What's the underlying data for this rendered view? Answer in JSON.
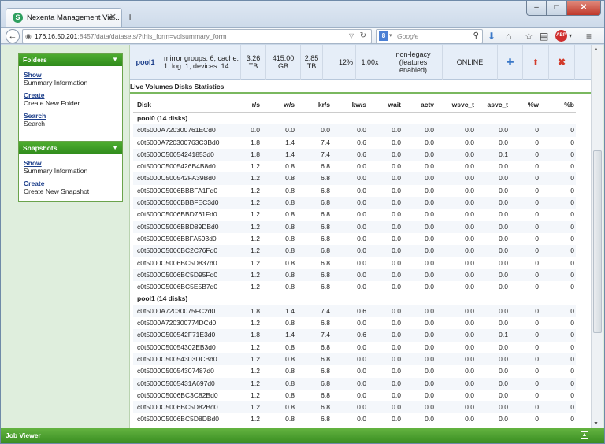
{
  "browser": {
    "tab_title": "Nexenta Management Vie...",
    "url_host": "176.16.50.201",
    "url_rest": ":8457/data/datasets/?this_form=volsummary_form",
    "search_placeholder": "Google",
    "search_engine_letter": "8"
  },
  "sidebar": {
    "folders": {
      "title": "Folders",
      "items": [
        {
          "link": "Show",
          "desc": "Summary Information"
        },
        {
          "link": "Create",
          "desc": "Create New Folder"
        },
        {
          "link": "Search",
          "desc": "Search"
        }
      ]
    },
    "snapshots": {
      "title": "Snapshots",
      "items": [
        {
          "link": "Show",
          "desc": "Summary Information"
        },
        {
          "link": "Create",
          "desc": "Create New Snapshot"
        }
      ]
    }
  },
  "pool": {
    "name": "pool1",
    "config": "mirror groups: 6, cache: 1, log: 1, devices: 14",
    "size": "3.26 TB",
    "allocated": "415.00 GB",
    "free": "2.85 TB",
    "capacity": "12%",
    "dedup": "1.00x",
    "version": "non-legacy (features enabled)",
    "health": "ONLINE"
  },
  "section_title": "Live Volumes Disks Statistics",
  "table": {
    "headers": [
      "Disk",
      "r/s",
      "w/s",
      "kr/s",
      "kw/s",
      "wait",
      "actv",
      "wsvc_t",
      "asvc_t",
      "%w",
      "%b"
    ],
    "groups": [
      {
        "label": "pool0 (14 disks)",
        "rows": [
          [
            "c0t5000A720300761ECd0",
            "0.0",
            "0.0",
            "0.0",
            "0.0",
            "0.0",
            "0.0",
            "0.0",
            "0.0",
            "0",
            "0"
          ],
          [
            "c0t5000A720300763C3Bd0",
            "1.8",
            "1.4",
            "7.4",
            "0.6",
            "0.0",
            "0.0",
            "0.0",
            "0.0",
            "0",
            "0"
          ],
          [
            "c0t5000C50054241853d0",
            "1.8",
            "1.4",
            "7.4",
            "0.6",
            "0.0",
            "0.0",
            "0.0",
            "0.1",
            "0",
            "0"
          ],
          [
            "c0t5000C5005426B4B8d0",
            "1.2",
            "0.8",
            "6.8",
            "0.0",
            "0.0",
            "0.0",
            "0.0",
            "0.0",
            "0",
            "0"
          ],
          [
            "c0t5000C500542FA39Bd0",
            "1.2",
            "0.8",
            "6.8",
            "0.0",
            "0.0",
            "0.0",
            "0.0",
            "0.0",
            "0",
            "0"
          ],
          [
            "c0t5000C5006BBBFA1Fd0",
            "1.2",
            "0.8",
            "6.8",
            "0.0",
            "0.0",
            "0.0",
            "0.0",
            "0.0",
            "0",
            "0"
          ],
          [
            "c0t5000C5006BBBFEC3d0",
            "1.2",
            "0.8",
            "6.8",
            "0.0",
            "0.0",
            "0.0",
            "0.0",
            "0.0",
            "0",
            "0"
          ],
          [
            "c0t5000C5006BBD761Fd0",
            "1.2",
            "0.8",
            "6.8",
            "0.0",
            "0.0",
            "0.0",
            "0.0",
            "0.0",
            "0",
            "0"
          ],
          [
            "c0t5000C5006BBD89DBd0",
            "1.2",
            "0.8",
            "6.8",
            "0.0",
            "0.0",
            "0.0",
            "0.0",
            "0.0",
            "0",
            "0"
          ],
          [
            "c0t5000C5006BBFA593d0",
            "1.2",
            "0.8",
            "6.8",
            "0.0",
            "0.0",
            "0.0",
            "0.0",
            "0.0",
            "0",
            "0"
          ],
          [
            "c0t5000C5006BC2C76Fd0",
            "1.2",
            "0.8",
            "6.8",
            "0.0",
            "0.0",
            "0.0",
            "0.0",
            "0.0",
            "0",
            "0"
          ],
          [
            "c0t5000C5006BC5D837d0",
            "1.2",
            "0.8",
            "6.8",
            "0.0",
            "0.0",
            "0.0",
            "0.0",
            "0.0",
            "0",
            "0"
          ],
          [
            "c0t5000C5006BC5D95Fd0",
            "1.2",
            "0.8",
            "6.8",
            "0.0",
            "0.0",
            "0.0",
            "0.0",
            "0.0",
            "0",
            "0"
          ],
          [
            "c0t5000C5006BC5E5B7d0",
            "1.2",
            "0.8",
            "6.8",
            "0.0",
            "0.0",
            "0.0",
            "0.0",
            "0.0",
            "0",
            "0"
          ]
        ]
      },
      {
        "label": "pool1 (14 disks)",
        "rows": [
          [
            "c0t5000A72030075FC2d0",
            "1.8",
            "1.4",
            "7.4",
            "0.6",
            "0.0",
            "0.0",
            "0.0",
            "0.0",
            "0",
            "0"
          ],
          [
            "c0t5000A720300774DCd0",
            "1.2",
            "0.8",
            "6.8",
            "0.0",
            "0.0",
            "0.0",
            "0.0",
            "0.0",
            "0",
            "0"
          ],
          [
            "c0t5000C500542F71E3d0",
            "1.8",
            "1.4",
            "7.4",
            "0.6",
            "0.0",
            "0.0",
            "0.0",
            "0.1",
            "0",
            "0"
          ],
          [
            "c0t5000C50054302EB3d0",
            "1.2",
            "0.8",
            "6.8",
            "0.0",
            "0.0",
            "0.0",
            "0.0",
            "0.0",
            "0",
            "0"
          ],
          [
            "c0t5000C50054303DCBd0",
            "1.2",
            "0.8",
            "6.8",
            "0.0",
            "0.0",
            "0.0",
            "0.0",
            "0.0",
            "0",
            "0"
          ],
          [
            "c0t5000C50054307487d0",
            "1.2",
            "0.8",
            "6.8",
            "0.0",
            "0.0",
            "0.0",
            "0.0",
            "0.0",
            "0",
            "0"
          ],
          [
            "c0t5000C5005431A697d0",
            "1.2",
            "0.8",
            "6.8",
            "0.0",
            "0.0",
            "0.0",
            "0.0",
            "0.0",
            "0",
            "0"
          ],
          [
            "c0t5000C5006BC3C82Bd0",
            "1.2",
            "0.8",
            "6.8",
            "0.0",
            "0.0",
            "0.0",
            "0.0",
            "0.0",
            "0",
            "0"
          ],
          [
            "c0t5000C5006BC5D82Bd0",
            "1.2",
            "0.8",
            "6.8",
            "0.0",
            "0.0",
            "0.0",
            "0.0",
            "0.0",
            "0",
            "0"
          ],
          [
            "c0t5000C5006BC5D8DBd0",
            "1.2",
            "0.8",
            "6.8",
            "0.0",
            "0.0",
            "0.0",
            "0.0",
            "0.0",
            "0",
            "0"
          ]
        ]
      }
    ]
  },
  "job_viewer": "Job Viewer"
}
